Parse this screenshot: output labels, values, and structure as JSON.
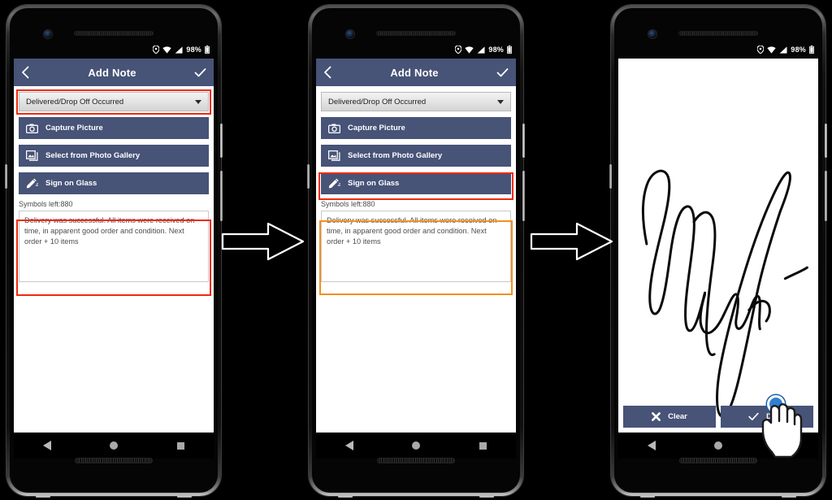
{
  "meta": {
    "background_color": "#000000",
    "accent_color": "#475377",
    "highlight_red": "#f0290d",
    "highlight_orange": "#f2901e"
  },
  "status_bar": {
    "battery_percent": "98%",
    "icons": [
      "location-pin-icon",
      "wifi-icon",
      "signal-bars-icon",
      "battery-icon"
    ]
  },
  "app_bar": {
    "title": "Add Note",
    "back_icon": "chevron-left-icon",
    "confirm_icon": "check-icon"
  },
  "form": {
    "dropdown": {
      "value": "Delivered/Drop Off Occurred",
      "caret_icon": "caret-down-icon"
    },
    "buttons": [
      {
        "label": "Capture Picture",
        "icon": "camera-icon"
      },
      {
        "label": "Select from Photo Gallery",
        "icon": "photo-gallery-icon"
      },
      {
        "label": "Sign on Glass",
        "icon": "signature-pen-icon"
      }
    ],
    "symbols_left": "Symbols left:880",
    "note_text": "Delivery was successful. All items were received on time, in apparent good order and condition. Next order + 10 items"
  },
  "signature_screen": {
    "clear_label": "Clear",
    "clear_icon": "x-mark-icon",
    "done_label": "Done",
    "done_icon": "check-icon",
    "signature_alt": "handwritten-signature"
  },
  "nav_bar": {
    "back_icon": "triangle-back-icon",
    "home_icon": "circle-home-icon",
    "recents_icon": "square-recents-icon"
  },
  "panels": [
    {
      "id": "panel-1",
      "highlights": [
        "dropdown",
        "note"
      ],
      "highlight_color": "#f0290d"
    },
    {
      "id": "panel-2",
      "highlights": [
        "sign-on-glass",
        "note"
      ],
      "highlight_color_primary": "#f0290d",
      "highlight_color_secondary": "#f2901e"
    },
    {
      "id": "panel-3",
      "highlights": [],
      "shows": "signature-capture"
    }
  ],
  "flow_arrows": [
    {
      "id": "arrow-1",
      "direction": "right"
    },
    {
      "id": "arrow-2",
      "direction": "right"
    }
  ]
}
